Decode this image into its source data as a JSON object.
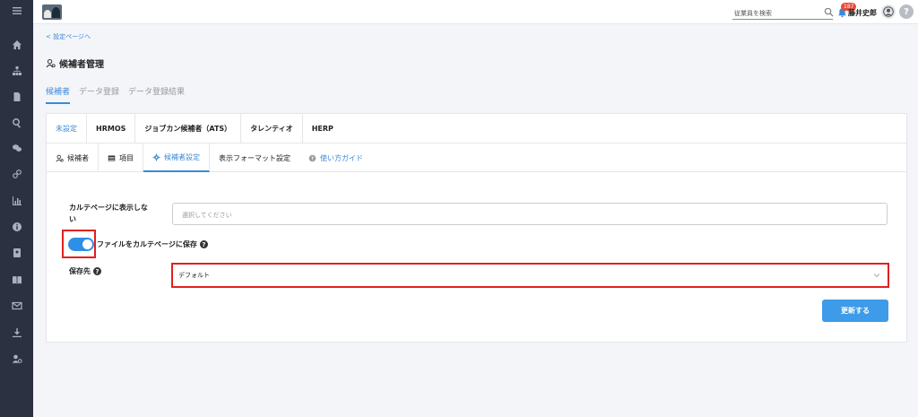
{
  "header": {
    "search_placeholder": "従業員を検索",
    "notification_count": "187",
    "user_name": "藤井史郎",
    "help_label": "?"
  },
  "nav": {
    "back_link": "< 設定ページへ",
    "page_title": "候補者管理"
  },
  "top_tabs": [
    {
      "label": "候補者",
      "active": true
    },
    {
      "label": "データ登録",
      "active": false
    },
    {
      "label": "データ登録結果",
      "active": false
    }
  ],
  "ats_tabs": [
    {
      "label": "未設定",
      "active": true
    },
    {
      "label": "HRMOS",
      "active": false
    },
    {
      "label": "ジョブカン候補者（ATS）",
      "active": false
    },
    {
      "label": "タレンティオ",
      "active": false
    },
    {
      "label": "HERP",
      "active": false
    }
  ],
  "sub_tabs": [
    {
      "label": "候補者",
      "icon": "user-icon"
    },
    {
      "label": "項目",
      "icon": "list-icon"
    },
    {
      "label": "候補者設定",
      "icon": "gear-icon",
      "active": true
    },
    {
      "label": "表示フォーマット設定"
    },
    {
      "label": "使い方ガイド",
      "icon": "question-icon"
    }
  ],
  "form": {
    "hide_label_line1": "カルテページに表示しな",
    "hide_label_line2": "い",
    "hide_placeholder": "選択してください",
    "toggle_label": "ファイルをカルテページに保存",
    "toggle_on": true,
    "save_dest_label": "保存先",
    "save_dest_value": "デフォルト",
    "update_button": "更新する"
  },
  "colors": {
    "accent": "#3a89d8",
    "sidebar": "#2b3140",
    "highlight": "#e02020",
    "button": "#3d9be9"
  }
}
